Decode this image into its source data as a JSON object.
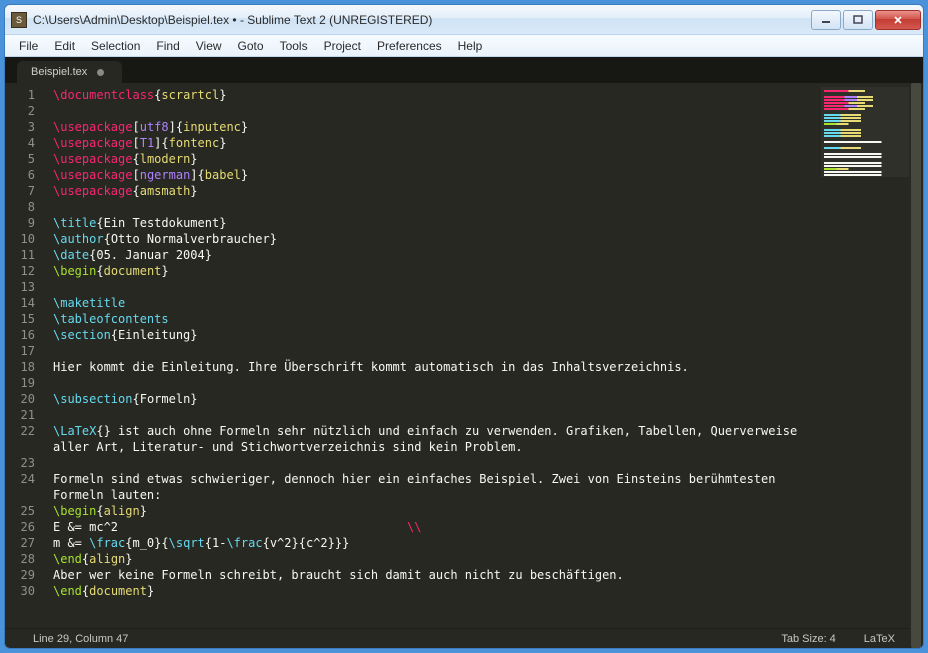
{
  "window": {
    "title": "C:\\Users\\Admin\\Desktop\\Beispiel.tex • - Sublime Text 2 (UNREGISTERED)"
  },
  "menu": {
    "file": "File",
    "edit": "Edit",
    "selection": "Selection",
    "find": "Find",
    "view": "View",
    "goto": "Goto",
    "tools": "Tools",
    "project": "Project",
    "preferences": "Preferences",
    "help": "Help"
  },
  "tab": {
    "label": "Beispiel.tex"
  },
  "status": {
    "position": "Line 29, Column 47",
    "tabsize": "Tab Size: 4",
    "syntax": "LaTeX"
  },
  "code": {
    "lines": [
      {
        "n": 1,
        "t": "cmd-brace",
        "cmd": "\\documentclass",
        "arg": "scrartcl"
      },
      {
        "n": 2,
        "t": "blank"
      },
      {
        "n": 3,
        "t": "cmd-opt-brace",
        "cmd": "\\usepackage",
        "opt": "utf8",
        "arg": "inputenc"
      },
      {
        "n": 4,
        "t": "cmd-opt-brace",
        "cmd": "\\usepackage",
        "opt": "T1",
        "arg": "fontenc"
      },
      {
        "n": 5,
        "t": "cmd-brace",
        "cmd": "\\usepackage",
        "arg": "lmodern"
      },
      {
        "n": 6,
        "t": "cmd-opt-brace",
        "cmd": "\\usepackage",
        "opt": "ngerman",
        "arg": "babel"
      },
      {
        "n": 7,
        "t": "cmd-brace",
        "cmd": "\\usepackage",
        "arg": "amsmath"
      },
      {
        "n": 8,
        "t": "blank"
      },
      {
        "n": 9,
        "t": "kw-brace",
        "cmd": "\\title",
        "arg": "Ein Testdokument"
      },
      {
        "n": 10,
        "t": "kw-brace",
        "cmd": "\\author",
        "arg": "Otto Normalverbraucher"
      },
      {
        "n": 11,
        "t": "kw-brace",
        "cmd": "\\date",
        "arg": "05. Januar 2004"
      },
      {
        "n": 12,
        "t": "begin",
        "cmd": "\\begin",
        "arg": "document"
      },
      {
        "n": 13,
        "t": "blank"
      },
      {
        "n": 14,
        "t": "kw",
        "cmd": "\\maketitle"
      },
      {
        "n": 15,
        "t": "kw",
        "cmd": "\\tableofcontents"
      },
      {
        "n": 16,
        "t": "kw-brace",
        "cmd": "\\section",
        "arg": "Einleitung"
      },
      {
        "n": 17,
        "t": "blank"
      },
      {
        "n": 18,
        "t": "text",
        "text": "Hier kommt die Einleitung. Ihre Überschrift kommt automatisch in das Inhaltsverzeichnis."
      },
      {
        "n": 19,
        "t": "blank"
      },
      {
        "n": 20,
        "t": "kw-brace",
        "cmd": "\\subsection",
        "arg": "Formeln"
      },
      {
        "n": 21,
        "t": "blank"
      },
      {
        "n": 22,
        "t": "latex-text",
        "prefix": "\\LaTeX",
        "arg": "",
        "text": " ist auch ohne Formeln sehr nützlich und einfach zu verwenden. Grafiken, Tabellen, Querverweise"
      },
      {
        "n": null,
        "cont": true,
        "t": "text",
        "text": "aller Art, Literatur- und Stichwortverzeichnis sind kein Problem."
      },
      {
        "n": 23,
        "t": "blank"
      },
      {
        "n": 24,
        "t": "text",
        "text": "Formeln sind etwas schwieriger, dennoch hier ein einfaches Beispiel. Zwei von Einsteins berühmtesten"
      },
      {
        "n": null,
        "cont": true,
        "t": "text",
        "text": "Formeln lauten:"
      },
      {
        "n": 25,
        "t": "begin",
        "cmd": "\\begin",
        "arg": "align"
      },
      {
        "n": 26,
        "t": "math1",
        "text": "E &= mc^2",
        "tail": "\\\\"
      },
      {
        "n": 27,
        "t": "math2"
      },
      {
        "n": 28,
        "t": "end",
        "cmd": "\\end",
        "arg": "align"
      },
      {
        "n": 29,
        "t": "text",
        "hl": true,
        "text": "Aber wer keine Formeln schreibt, braucht sich damit auch nicht zu beschäftigen."
      },
      {
        "n": 30,
        "t": "end",
        "cmd": "\\end",
        "arg": "document"
      }
    ]
  }
}
